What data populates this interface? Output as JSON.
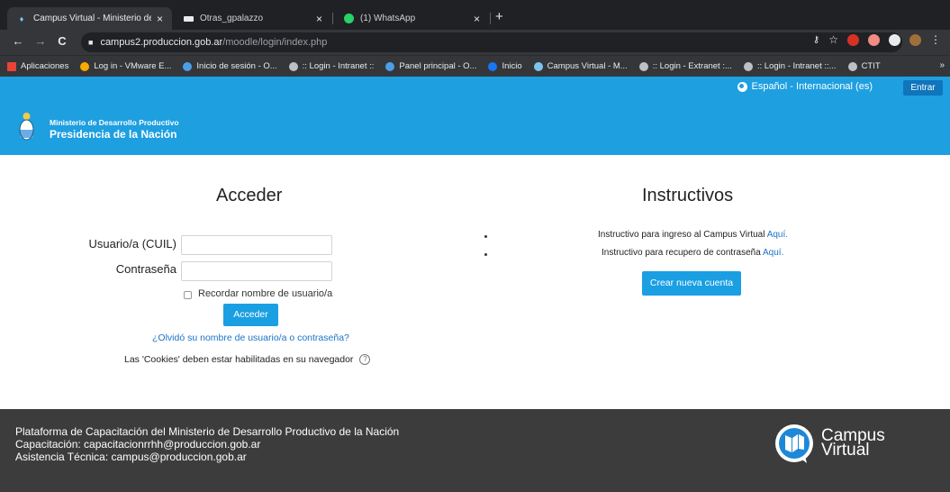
{
  "browser": {
    "tabs": [
      {
        "title": "Campus Virtual - Ministerio de D",
        "active": true
      },
      {
        "title": "Otras_gpalazzo",
        "active": false
      },
      {
        "title": "(1) WhatsApp",
        "active": false
      }
    ],
    "url_host": "campus2.produccion.gob.ar",
    "url_path": "/moodle/login/index.php",
    "bookmarks": [
      {
        "label": "Aplicaciones",
        "icon": "apps-grid-icon",
        "color": "#ea4335"
      },
      {
        "label": "Log in - VMware E...",
        "icon": "vmware-icon",
        "color": "#f9ab00"
      },
      {
        "label": "Inicio de sesión - O...",
        "icon": "office-icon",
        "color": "#4a9fe8"
      },
      {
        "label": ":: Login - Intranet ::",
        "icon": "globe-icon",
        "color": "#bdc1c6"
      },
      {
        "label": "Panel principal - O...",
        "icon": "office-icon",
        "color": "#4a9fe8"
      },
      {
        "label": "Inicio",
        "icon": "facebook-icon",
        "color": "#1877f2"
      },
      {
        "label": "Campus Virtual - M...",
        "icon": "emblem-icon",
        "color": "#7cc4ee"
      },
      {
        "label": ":: Login - Extranet :...",
        "icon": "globe-icon",
        "color": "#bdc1c6"
      },
      {
        "label": ":: Login - Intranet ::...",
        "icon": "globe-icon",
        "color": "#bdc1c6"
      },
      {
        "label": "CTIT",
        "icon": "globe-icon",
        "color": "#bdc1c6"
      }
    ],
    "more_bookmarks": "»"
  },
  "topbar": {
    "language": "Español - Internacional (es)",
    "login_button": "Entrar",
    "accent_color": "#1e9fe0"
  },
  "header": {
    "org_small": "Ministerio de Desarrollo Productivo",
    "org_big": "Presidencia de la Nación"
  },
  "login": {
    "title": "Acceder",
    "username_label": "Usuario/a (CUIL)",
    "username_value": "",
    "password_label": "Contraseña",
    "password_value": "",
    "remember_label": "Recordar nombre de usuario/a",
    "remember_checked": false,
    "submit": "Acceder",
    "forgot": "¿Olvidó su nombre de usuario/a o contraseña?",
    "cookies": "Las 'Cookies' deben estar habilitadas en su navegador"
  },
  "instructivos": {
    "title": "Instructivos",
    "items": [
      {
        "text": "Instructivo para ingreso al Campus Virtual ",
        "link": "Aquí."
      },
      {
        "text": "Instructivo para recupero de contraseña ",
        "link": "Aquí."
      }
    ],
    "create_account": "Crear nueva cuenta"
  },
  "footer": {
    "lines": [
      "Plataforma de Capacitación del Ministerio de Desarrollo Productivo de la Nación",
      "Capacitación: capacitacionrrhh@produccion.gob.ar",
      "Asistencia Técnica: campus@produccion.gob.ar"
    ],
    "logo_line1": "Campus",
    "logo_line2": "Virtual"
  }
}
